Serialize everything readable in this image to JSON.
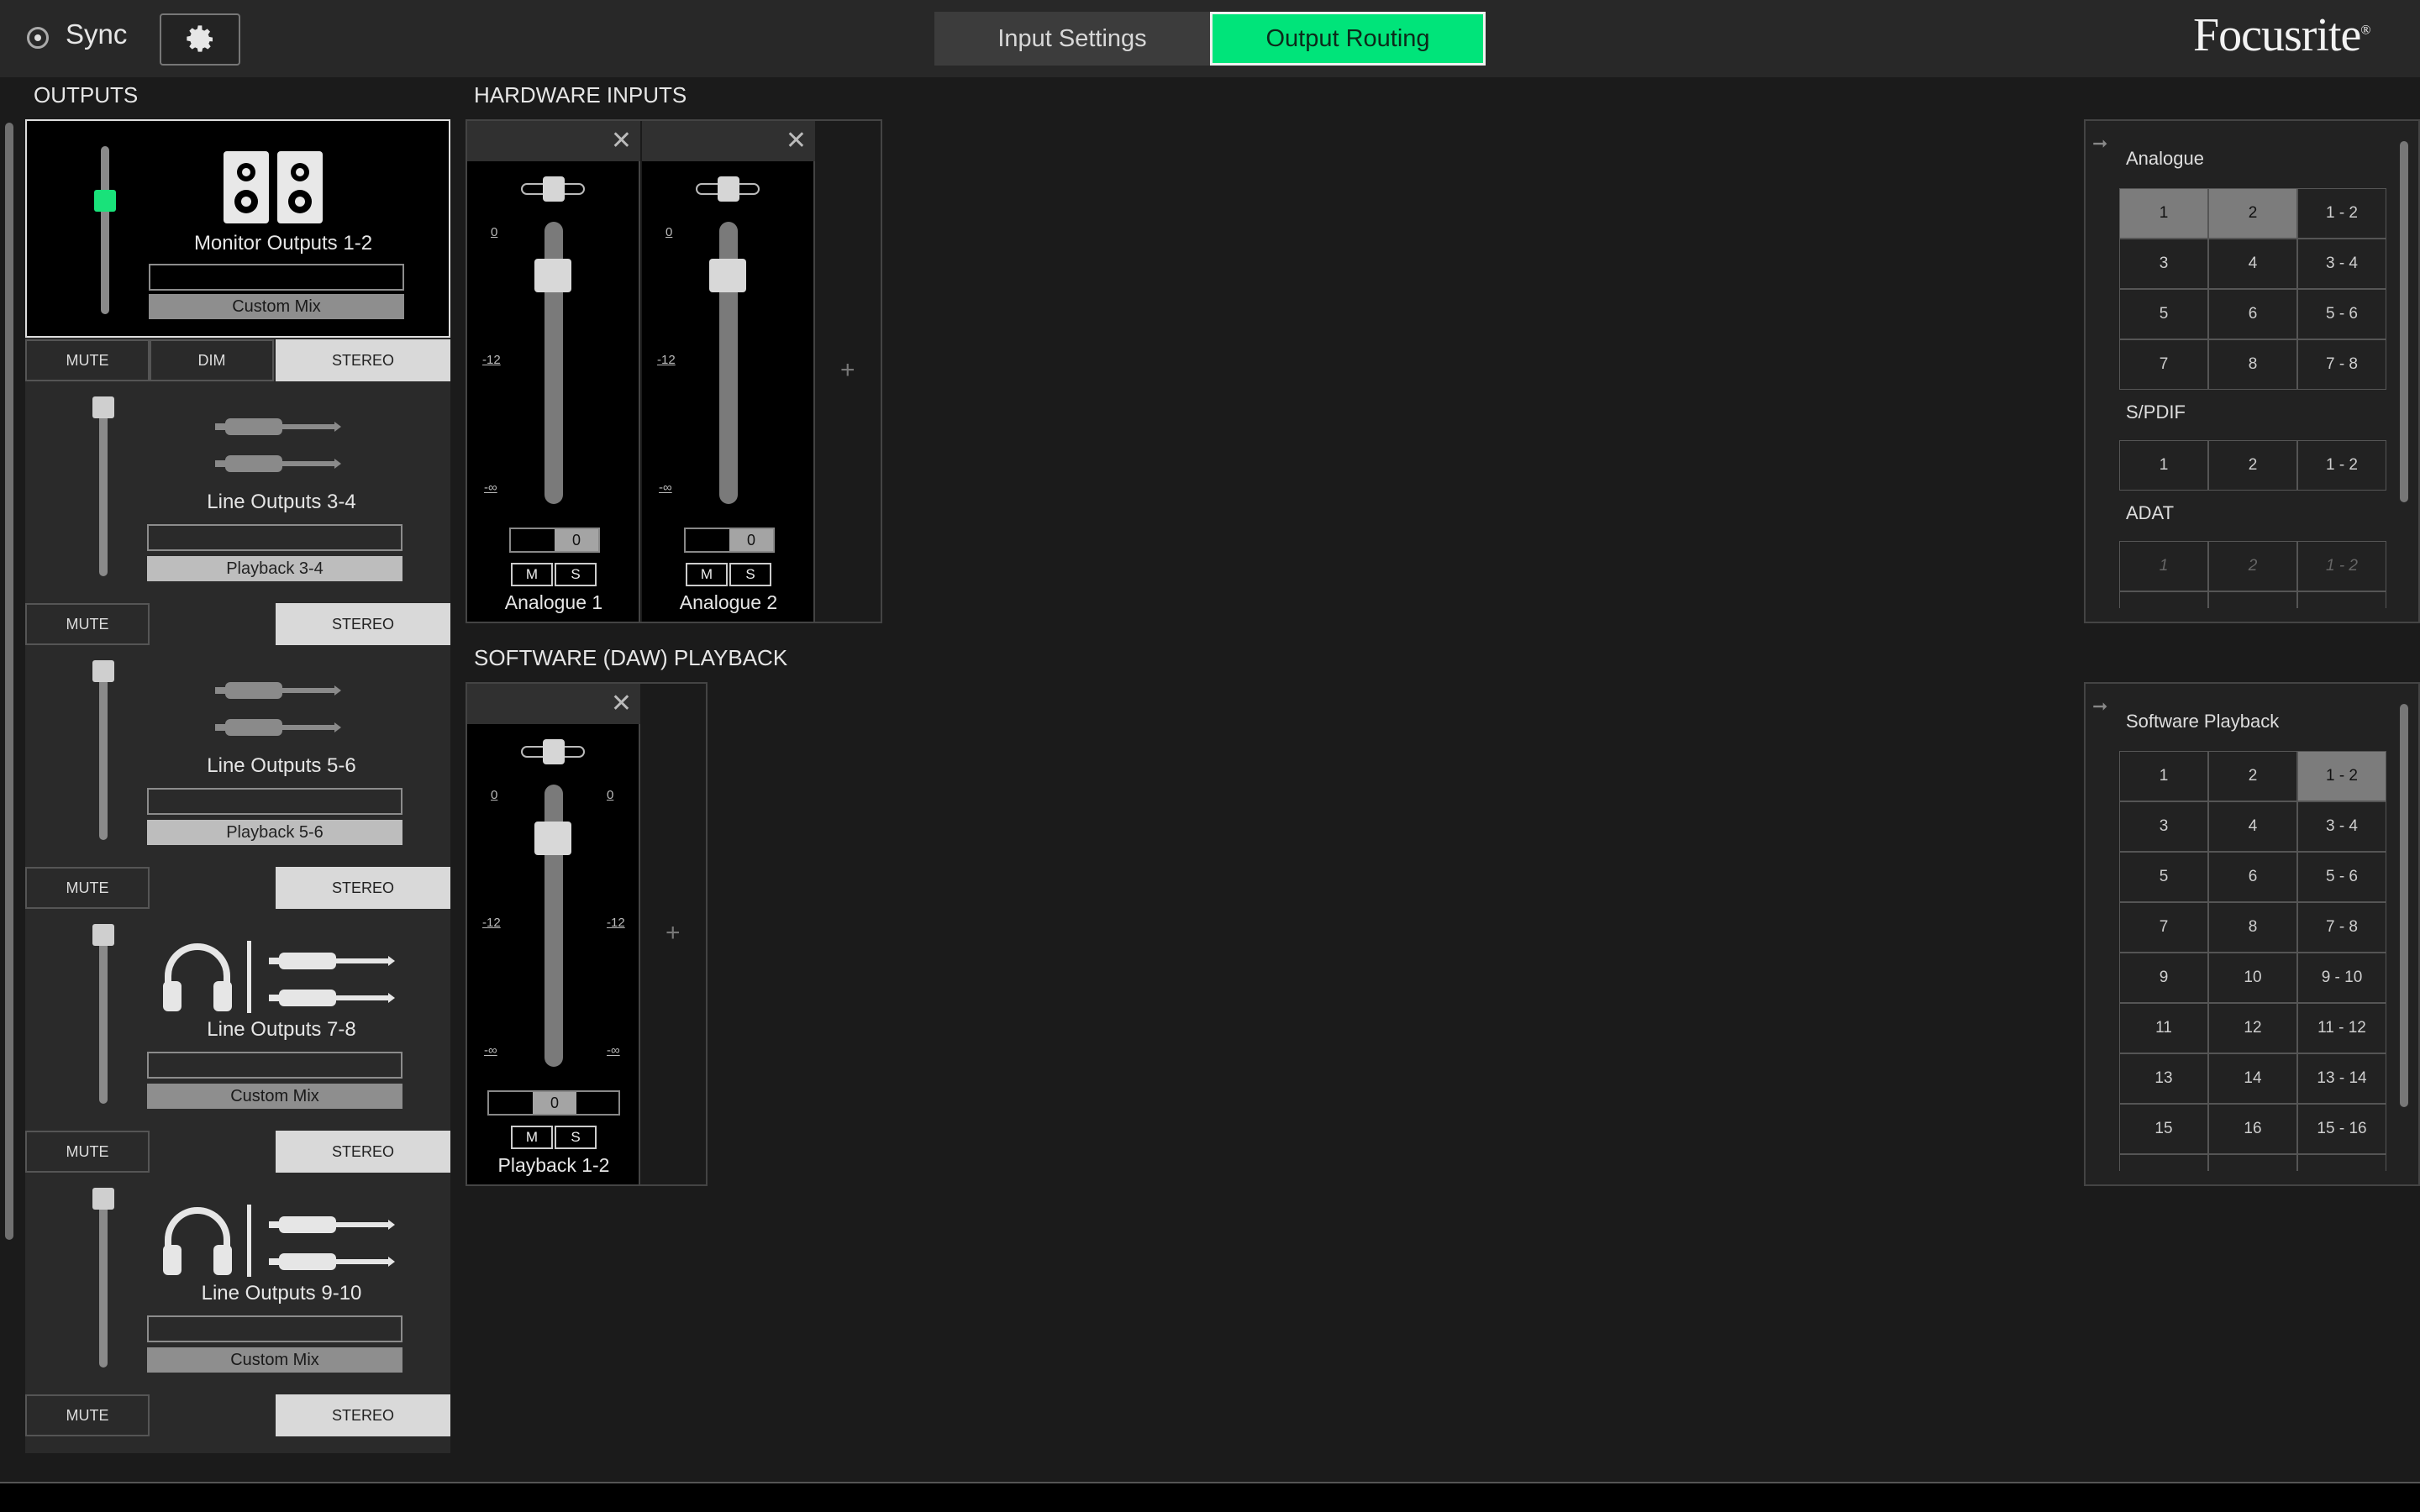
{
  "topbar": {
    "sync_label": "Sync",
    "tabs": [
      {
        "label": "Input Settings"
      },
      {
        "label": "Output Routing"
      }
    ],
    "active_tab": "Output Routing",
    "brand": "Focusrite"
  },
  "outputs": {
    "title": "OUTPUTS",
    "cards": [
      {
        "name": "Monitor Outputs 1-2",
        "source": "Custom Mix",
        "selected": true,
        "icon": "monitor-speakers-icon",
        "level": 0.3,
        "buttons": [
          "MUTE",
          "DIM",
          "STEREO"
        ]
      },
      {
        "name": "Line Outputs 3-4",
        "source": "Playback 3-4",
        "icon": "line-cable-icon",
        "level": 0.0,
        "buttons": [
          "MUTE",
          "STEREO"
        ]
      },
      {
        "name": "Line Outputs 5-6",
        "source": "Playback 5-6",
        "icon": "line-cable-icon",
        "level": 0.0,
        "buttons": [
          "MUTE",
          "STEREO"
        ]
      },
      {
        "name": "Line Outputs 7-8",
        "source": "Custom Mix",
        "icon": "headphones-icon",
        "level": 0.0,
        "buttons": [
          "MUTE",
          "STEREO"
        ]
      },
      {
        "name": "Line Outputs 9-10",
        "source": "Custom Mix",
        "icon": "headphones-icon",
        "level": 0.0,
        "buttons": [
          "MUTE",
          "STEREO"
        ]
      }
    ]
  },
  "hardware_inputs": {
    "title": "HARDWARE INPUTS",
    "strips": [
      {
        "name": "Analogue 1",
        "gain": "0",
        "mute": "M",
        "solo": "S",
        "scale": [
          "0",
          "-12",
          "-∞"
        ],
        "fader": 0.79
      },
      {
        "name": "Analogue 2",
        "gain": "0",
        "mute": "M",
        "solo": "S",
        "scale": [
          "0",
          "-12",
          "-∞"
        ],
        "fader": 0.79
      }
    ],
    "add": "+"
  },
  "software_playback": {
    "title": "SOFTWARE (DAW) PLAYBACK",
    "strips": [
      {
        "name": "Playback 1-2",
        "gain": "0",
        "mute": "M",
        "solo": "S",
        "scale": [
          "0",
          "-12",
          "-∞"
        ],
        "scale_right": [
          "0",
          "-12",
          "-∞"
        ],
        "fader": 0.79
      }
    ],
    "add": "+"
  },
  "hw_sources": {
    "groups": [
      {
        "title": "Analogue",
        "cells": [
          "1",
          "2",
          "1 - 2",
          "3",
          "4",
          "3 - 4",
          "5",
          "6",
          "5 - 6",
          "7",
          "8",
          "7 - 8"
        ],
        "selected": [
          "1",
          "2"
        ]
      },
      {
        "title": "S/PDIF",
        "cells": [
          "1",
          "2",
          "1 - 2"
        ],
        "selected": []
      },
      {
        "title": "ADAT",
        "cells": [
          "1",
          "2",
          "1 - 2"
        ],
        "disabled": true
      }
    ]
  },
  "sw_sources": {
    "title": "Software Playback",
    "cells": [
      "1",
      "2",
      "1 - 2",
      "3",
      "4",
      "3 - 4",
      "5",
      "6",
      "5 - 6",
      "7",
      "8",
      "7 - 8",
      "9",
      "10",
      "9 - 10",
      "11",
      "12",
      "11 - 12",
      "13",
      "14",
      "13 - 14",
      "15",
      "16",
      "15 - 16"
    ],
    "selected": [
      "1 - 2"
    ]
  },
  "colors": {
    "accent": "#00e47a",
    "background": "#1b1b1b",
    "panel": "#2a2a2a"
  }
}
